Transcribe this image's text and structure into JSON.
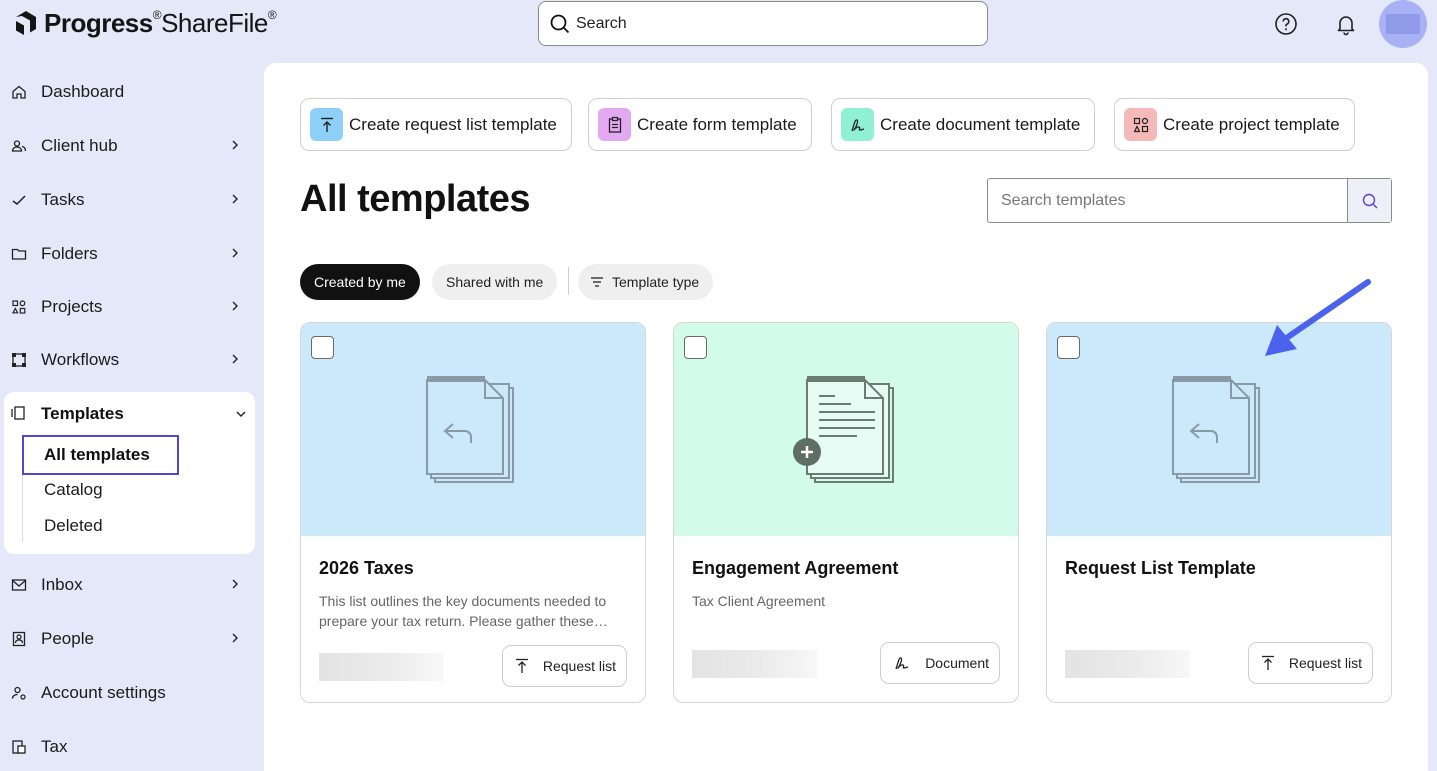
{
  "app": {
    "brand_bold": "Progress",
    "brand_light": "ShareFile",
    "trademark": "®"
  },
  "header": {
    "search_label": "Search"
  },
  "sidebar": {
    "items": [
      {
        "label": "Dashboard",
        "icon": "home-icon"
      },
      {
        "label": "Client hub",
        "icon": "users-icon"
      },
      {
        "label": "Tasks",
        "icon": "check-icon"
      },
      {
        "label": "Folders",
        "icon": "folder-icon"
      },
      {
        "label": "Projects",
        "icon": "projects-icon"
      },
      {
        "label": "Workflows",
        "icon": "workflows-icon"
      },
      {
        "label": "Templates",
        "icon": "templates-icon"
      },
      {
        "label": "Inbox",
        "icon": "inbox-icon"
      },
      {
        "label": "People",
        "icon": "people-icon"
      },
      {
        "label": "Account settings",
        "icon": "account-settings-icon"
      },
      {
        "label": "Tax",
        "icon": "tax-icon"
      }
    ],
    "templates_sub": [
      "All templates",
      "Catalog",
      "Deleted"
    ]
  },
  "create_buttons": [
    {
      "label": "Create request list template",
      "color": "#8ed0f7"
    },
    {
      "label": "Create form template",
      "color": "#e3a9f0"
    },
    {
      "label": "Create document template",
      "color": "#8ff0d3"
    },
    {
      "label": "Create project template",
      "color": "#f6b9b9"
    }
  ],
  "page": {
    "title": "All templates",
    "search_placeholder": "Search templates"
  },
  "filters": {
    "created_by_me": "Created by me",
    "shared_with_me": "Shared with me",
    "template_type": "Template type"
  },
  "cards": [
    {
      "title": "2026 Taxes",
      "description": "This list outlines the key documents needed to prepare your tax return. Please gather these…",
      "type_label": "Request list",
      "color": "#cce8fb"
    },
    {
      "title": "Engagement Agreement",
      "description": "Tax Client Agreement",
      "type_label": "Document",
      "color": "#d3fbec"
    },
    {
      "title": "Request List Template",
      "description": "",
      "type_label": "Request list",
      "color": "#cce8fb"
    }
  ],
  "colors": {
    "accent": "#5544cc",
    "annotation_arrow": "#4b63ec"
  }
}
